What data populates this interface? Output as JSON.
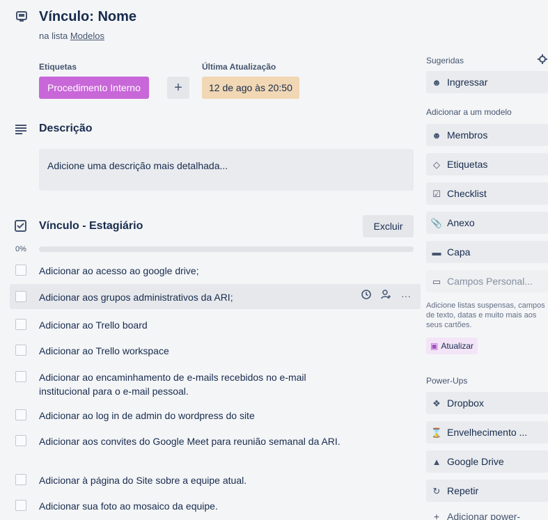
{
  "card": {
    "title": "Vínculo: Nome",
    "list_prefix": "na lista ",
    "list_name": "Modelos"
  },
  "labels": {
    "heading": "Etiquetas",
    "items": [
      {
        "text": "Procedimento Interno",
        "color": "#c867d8"
      }
    ],
    "add_symbol": "+"
  },
  "last_update": {
    "heading": "Última Atualização",
    "value": "12 de ago às 20:50"
  },
  "description": {
    "heading": "Descrição",
    "placeholder": "Adicione uma descrição mais detalhada..."
  },
  "checklist": {
    "title": "Vínculo - Estagiário",
    "delete_label": "Excluir",
    "progress_percent": 0,
    "progress_label": "0%",
    "items": [
      "Adicionar ao acesso ao google drive;",
      "Adicionar aos grupos administrativos da ARI;",
      "Adicionar ao Trello board",
      "Adicionar ao Trello workspace",
      "Adicionar ao encaminhamento de e-mails recebidos no e-mail institucional para o e-mail pessoal.",
      "Adicionar ao log in de admin do wordpress do site",
      "Adicionar aos convites do Google Meet para reunião semanal da ARI.",
      "Adicionar à página do Site sobre a equipe atual.",
      "Adicionar sua foto ao mosaico da equipe."
    ],
    "item_more": "···"
  },
  "sidebar": {
    "suggested_heading": "Sugeridas",
    "join_label": "Ingressar",
    "add_to_template_heading": "Adicionar a um modelo",
    "actions": {
      "members": "Membros",
      "labels": "Etiquetas",
      "checklist": "Checklist",
      "attachment": "Anexo",
      "cover": "Capa",
      "custom_fields": "Campos Personal..."
    },
    "custom_fields_note": "Adicione listas suspensas, campos de texto, datas e muito mais aos seus cartões.",
    "upgrade_label": "Atualizar",
    "powerups_heading": "Power-Ups",
    "powerups": {
      "dropbox": "Dropbox",
      "aging": "Envelhecimento ...",
      "google_drive": "Google Drive",
      "repeat": "Repetir",
      "add": "Adicionar power-"
    }
  },
  "colors": {
    "label_purple": "#c867d8",
    "date_badge": "#f1d7b4"
  }
}
